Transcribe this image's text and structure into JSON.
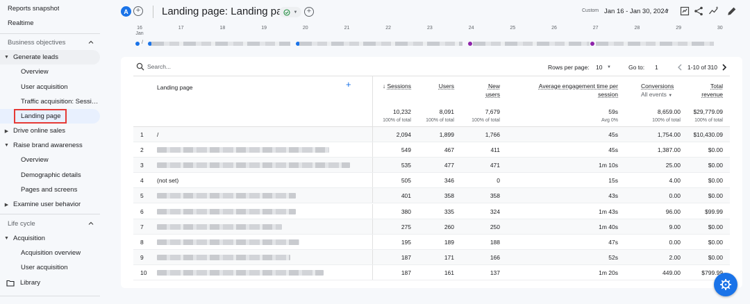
{
  "sidebar": {
    "reports_snapshot": "Reports snapshot",
    "realtime": "Realtime",
    "business_objectives": "Business objectives",
    "generate_leads": "Generate leads",
    "overview1": "Overview",
    "user_acquisition1": "User acquisition",
    "traffic_acquisition": "Traffic acquisition: Session...",
    "landing_page": "Landing page",
    "drive_online_sales": "Drive online sales",
    "raise_brand_awareness": "Raise brand awareness",
    "overview2": "Overview",
    "demographic_details": "Demographic details",
    "pages_and_screens": "Pages and screens",
    "examine_user_behavior": "Examine user behavior",
    "life_cycle": "Life cycle",
    "acquisition": "Acquisition",
    "acquisition_overview": "Acquisition overview",
    "user_acquisition2": "User acquisition",
    "library": "Library"
  },
  "header": {
    "avatar_letter": "A",
    "title": "Landing page: Landing page",
    "custom_label": "Custom",
    "date_range": "Jan 16 - Jan 30, 2024"
  },
  "timeline": {
    "ticks": [
      "16",
      "17",
      "18",
      "19",
      "20",
      "21",
      "22",
      "23",
      "24",
      "25",
      "26",
      "27",
      "28",
      "29",
      "30"
    ],
    "first_month": "Jan",
    "slash": "/"
  },
  "toolbar": {
    "search_placeholder": "Search...",
    "rows_per_page_label": "Rows per page:",
    "rows_per_page_value": "10",
    "goto_label": "Go to:",
    "goto_value": "1",
    "pagination": "1-10 of 310"
  },
  "columns": {
    "landing_page": "Landing page",
    "sessions": "Sessions",
    "users": "Users",
    "new_users_1": "New",
    "new_users_2": "users",
    "avg_eng_1": "Average engagement time per",
    "avg_eng_2": "session",
    "conversions": "Conversions",
    "all_events": "All events",
    "total_revenue_1": "Total",
    "total_revenue_2": "revenue"
  },
  "totals": {
    "sessions": "10,232",
    "sessions_sub": "100% of total",
    "users": "8,091",
    "users_sub": "100% of total",
    "new_users": "7,679",
    "new_users_sub": "100% of total",
    "avg_eng": "59s",
    "avg_eng_sub": "Avg 0%",
    "conversions": "8,659.00",
    "conversions_sub": "100% of total",
    "revenue": "$29,779.09",
    "revenue_sub": "100% of total"
  },
  "rows": [
    {
      "n": "1",
      "page": "/",
      "sessions": "2,094",
      "users": "1,899",
      "new_users": "1,766",
      "eng": "45s",
      "conv": "1,754.00",
      "rev": "$10,430.09"
    },
    {
      "n": "2",
      "page": "",
      "sessions": "549",
      "users": "467",
      "new_users": "411",
      "eng": "45s",
      "conv": "1,387.00",
      "rev": "$0.00"
    },
    {
      "n": "3",
      "page": "",
      "sessions": "535",
      "users": "477",
      "new_users": "471",
      "eng": "1m 10s",
      "conv": "25.00",
      "rev": "$0.00"
    },
    {
      "n": "4",
      "page": "(not set)",
      "sessions": "505",
      "users": "346",
      "new_users": "0",
      "eng": "15s",
      "conv": "4.00",
      "rev": "$0.00"
    },
    {
      "n": "5",
      "page": "",
      "sessions": "401",
      "users": "358",
      "new_users": "358",
      "eng": "43s",
      "conv": "0.00",
      "rev": "$0.00"
    },
    {
      "n": "6",
      "page": "",
      "sessions": "380",
      "users": "335",
      "new_users": "324",
      "eng": "1m 43s",
      "conv": "96.00",
      "rev": "$99.99"
    },
    {
      "n": "7",
      "page": "",
      "sessions": "275",
      "users": "260",
      "new_users": "250",
      "eng": "1m 40s",
      "conv": "9.00",
      "rev": "$0.00"
    },
    {
      "n": "8",
      "page": "",
      "sessions": "195",
      "users": "189",
      "new_users": "188",
      "eng": "47s",
      "conv": "0.00",
      "rev": "$0.00"
    },
    {
      "n": "9",
      "page": "",
      "sessions": "187",
      "users": "171",
      "new_users": "166",
      "eng": "52s",
      "conv": "2.00",
      "rev": "$0.00"
    },
    {
      "n": "10",
      "page": "",
      "sessions": "187",
      "users": "161",
      "new_users": "137",
      "eng": "1m 20s",
      "conv": "449.00",
      "rev": "$799.99"
    }
  ],
  "colors": {
    "accent": "#1a73e8",
    "active_bg": "#e8f0fe",
    "highlight": "#e53935",
    "success": "#1e8e3e"
  }
}
